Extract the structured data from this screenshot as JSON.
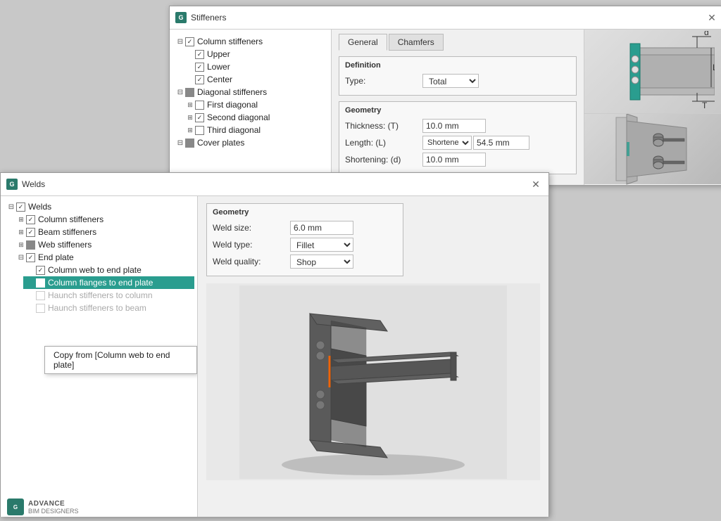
{
  "stiffeners_dialog": {
    "title": "Stiffeners",
    "tabs": [
      "General",
      "Chamfers"
    ],
    "active_tab": "General",
    "tree": {
      "column_stiffeners": {
        "label": "Column stiffeners",
        "checked": true,
        "children": [
          "Upper",
          "Lower",
          "Center"
        ]
      },
      "diagonal_stiffeners": {
        "label": "Diagonal stiffeners",
        "checked": "square",
        "children": [
          "First diagonal",
          "Second diagonal",
          "Third diagonal"
        ]
      },
      "cover_plates": {
        "label": "Cover plates",
        "checked": "square"
      }
    },
    "definition": {
      "label": "Definition",
      "type_label": "Type:",
      "type_value": "Total"
    },
    "geometry": {
      "label": "Geometry",
      "thickness_label": "Thickness: (T)",
      "thickness_value": "10.0 mm",
      "length_label": "Length: (L)",
      "length_mode": "Shortened",
      "length_value": "54.5 mm",
      "shortening_label": "Shortening: (d)",
      "shortening_value": "10.0 mm"
    }
  },
  "welds_dialog": {
    "title": "Welds",
    "tree": {
      "welds": {
        "label": "Welds",
        "checked": true,
        "children": {
          "column_stiffeners": {
            "label": "Column stiffeners",
            "checked": true
          },
          "beam_stiffeners": {
            "label": "Beam stiffeners",
            "checked": true
          },
          "web_stiffeners": {
            "label": "Web stiffeners",
            "checked": false,
            "square": true
          },
          "end_plate": {
            "label": "End plate",
            "checked": true,
            "children": {
              "column_web": {
                "label": "Column web to end plate",
                "checked": true
              },
              "column_flanges": {
                "label": "Column flanges to end plate",
                "checked": true,
                "highlighted": true
              },
              "haunch_col": {
                "label": "Haunch stiffeners to column",
                "checked": false,
                "disabled": true
              },
              "haunch_beam": {
                "label": "Haunch stiffeners to beam",
                "checked": false,
                "disabled": true
              }
            }
          }
        }
      }
    },
    "geometry": {
      "label": "Geometry",
      "weld_size_label": "Weld size:",
      "weld_size_value": "6.0 mm",
      "weld_type_label": "Weld type:",
      "weld_type_value": "Fillet",
      "weld_quality_label": "Weld quality:",
      "weld_quality_value": "Shop"
    },
    "context_menu": {
      "items": [
        "Copy from [Column web to end plate]"
      ]
    }
  },
  "brand": {
    "name": "ADVANCE",
    "sub": "BIM DESIGNERS"
  },
  "icons": {
    "close": "✕",
    "expand": "⊞",
    "collapse": "⊟",
    "check": "✓",
    "dropdown": "▾"
  }
}
